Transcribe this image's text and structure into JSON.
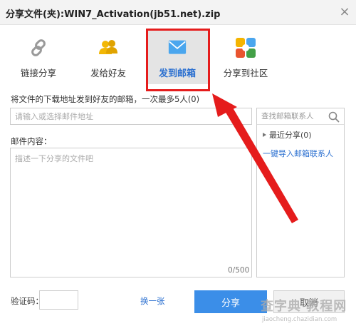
{
  "window": {
    "title": "分享文件(夹):WIN7_Activation(jb51.net).zip",
    "close_glyph": "×"
  },
  "tabs": [
    {
      "label": "链接分享",
      "icon": "link-icon"
    },
    {
      "label": "发给好友",
      "icon": "users-icon"
    },
    {
      "label": "发到邮箱",
      "icon": "mail-icon",
      "selected": true
    },
    {
      "label": "分享到社区",
      "icon": "community-icon"
    }
  ],
  "form": {
    "instruction": "将文件的下载地址发到好友的邮箱，一次最多5人(0)",
    "email_placeholder": "请输入或选择邮件地址",
    "message_label": "邮件内容：",
    "message_placeholder": "描述一下分享的文件吧",
    "char_count": "0/500"
  },
  "contacts": {
    "search_placeholder": "查找邮箱联系人",
    "recent_label": "最近分享(0)",
    "import_link": "一键导入邮箱联系人"
  },
  "footer": {
    "captcha_label": "验证码：",
    "refresh_link": "换一张",
    "share_button": "分享",
    "cancel_button": "取消"
  },
  "watermark": {
    "text": "查字典 教程网",
    "url": "jiaocheng.chazidian.com"
  },
  "colors": {
    "accent": "#3b8ee8",
    "link": "#2a6fd0",
    "annotation_red": "#e51c1c",
    "selected_tab_bg": "#e4e4e4"
  }
}
